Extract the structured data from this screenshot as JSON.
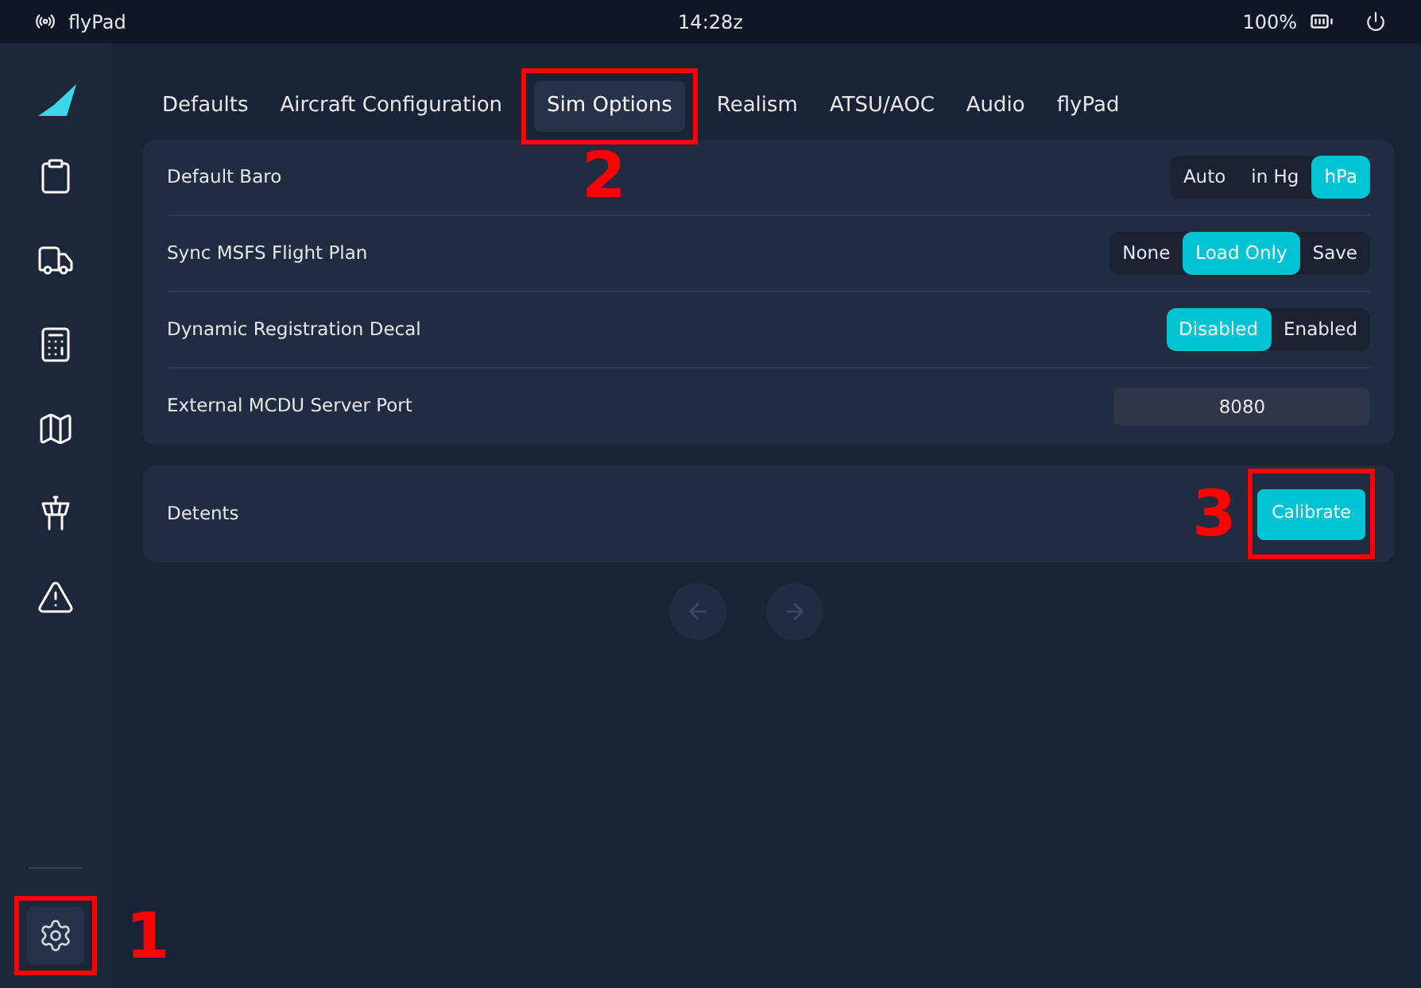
{
  "status_bar": {
    "app_name": "flyPad",
    "time": "14:28z",
    "battery": "100%"
  },
  "sidebar": {
    "items": [
      {
        "kind": "checklist",
        "selected": false
      },
      {
        "kind": "truck",
        "selected": false
      },
      {
        "kind": "calculator",
        "selected": false
      },
      {
        "kind": "map",
        "selected": false
      },
      {
        "kind": "tower",
        "selected": false
      },
      {
        "kind": "warning",
        "selected": false
      }
    ],
    "settings_item": {
      "selected": true,
      "callout": "1"
    }
  },
  "tabs": [
    {
      "label": "Defaults",
      "selected": false
    },
    {
      "label": "Aircraft Configuration",
      "selected": false
    },
    {
      "label": "Sim Options",
      "selected": true,
      "callout": "2"
    },
    {
      "label": "Realism",
      "selected": false
    },
    {
      "label": "ATSU/AOC",
      "selected": false
    },
    {
      "label": "Audio",
      "selected": false
    },
    {
      "label": "flyPad",
      "selected": false
    }
  ],
  "settings": [
    {
      "label": "Default Baro",
      "kind": "segmented",
      "options": [
        {
          "label": "Auto",
          "selected": false
        },
        {
          "label": "in Hg",
          "selected": false
        },
        {
          "label": "hPa",
          "selected": true
        }
      ]
    },
    {
      "label": "Sync MSFS Flight Plan",
      "kind": "segmented",
      "options": [
        {
          "label": "None",
          "selected": false
        },
        {
          "label": "Load Only",
          "selected": true
        },
        {
          "label": "Save",
          "selected": false
        }
      ]
    },
    {
      "label": "Dynamic Registration Decal",
      "kind": "segmented",
      "options": [
        {
          "label": "Disabled",
          "selected": true
        },
        {
          "label": "Enabled",
          "selected": false
        }
      ]
    },
    {
      "label": "External MCDU Server Port",
      "kind": "field",
      "value": "8080"
    }
  ],
  "detents": {
    "label": "Detents",
    "button": "Calibrate",
    "callout": "3"
  }
}
